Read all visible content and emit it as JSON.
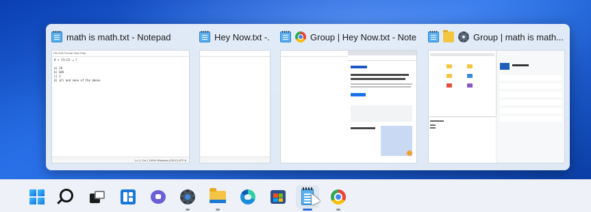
{
  "previews": [
    {
      "title": "math is math.txt - Notepad",
      "icons": [
        "notepad-icon"
      ]
    },
    {
      "title": "Hey Now.txt -...",
      "icons": [
        "notepad-icon"
      ]
    },
    {
      "title": "Group | Hey Now.txt - Note...",
      "icons": [
        "notepad-icon",
        "chrome-icon"
      ]
    },
    {
      "title": "Group | math is math...",
      "icons": [
        "notepad-icon",
        "file-explorer-icon",
        "settings-icon"
      ]
    }
  ],
  "notepad_thumb": {
    "menu": "File  Edit  Format  View  Help",
    "lines": [
      "8 + (5)(2) = ?",
      "",
      "a) 18",
      "b) 845",
      "c) 2",
      "d) all and none of the above"
    ],
    "status": "Ln 1, Col 1     100%     Windows (CRLF)     UTF-8"
  },
  "taskbar": {
    "items": [
      {
        "name": "start",
        "icon": "windows-logo-icon",
        "running": false
      },
      {
        "name": "search",
        "icon": "search-icon",
        "running": false
      },
      {
        "name": "task-view",
        "icon": "task-view-icon",
        "running": false
      },
      {
        "name": "widgets",
        "icon": "widgets-icon",
        "running": false
      },
      {
        "name": "chat",
        "icon": "chat-icon",
        "running": false
      },
      {
        "name": "settings",
        "icon": "settings-icon",
        "running": true
      },
      {
        "name": "file-explorer",
        "icon": "file-explorer-icon",
        "running": true
      },
      {
        "name": "edge",
        "icon": "edge-icon",
        "running": false
      },
      {
        "name": "store",
        "icon": "store-icon",
        "running": false
      },
      {
        "name": "notepad",
        "icon": "notepad-icon",
        "running": true,
        "active": true
      },
      {
        "name": "chrome",
        "icon": "chrome-icon",
        "running": true
      }
    ]
  },
  "colors": {
    "accent": "#2b6cd4",
    "wallpaper": "#1d5fd6",
    "flyout": "#e8eff8"
  }
}
